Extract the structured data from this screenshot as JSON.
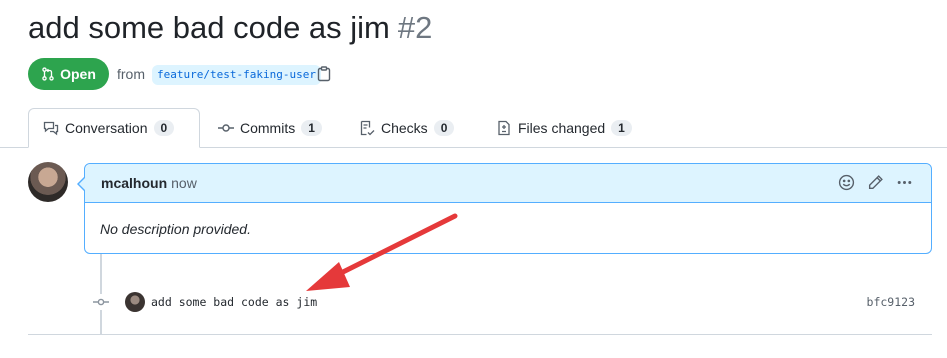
{
  "pr": {
    "title": "add some bad code as jim",
    "number": "#2",
    "state": "Open",
    "from_label": "from",
    "branch": "feature/test-faking-user"
  },
  "tabs": [
    {
      "label": "Conversation",
      "count": "0",
      "icon": "comment-discussion-icon"
    },
    {
      "label": "Commits",
      "count": "1",
      "icon": "git-commit-icon"
    },
    {
      "label": "Checks",
      "count": "0",
      "icon": "checklist-icon"
    },
    {
      "label": "Files changed",
      "count": "1",
      "icon": "file-diff-icon"
    }
  ],
  "comment": {
    "author": "mcalhoun",
    "time": "now",
    "body": "No description provided."
  },
  "commit": {
    "message": "add some bad code as jim",
    "sha": "bfc9123"
  },
  "colors": {
    "open_green": "#2da44e",
    "accent_blue": "#0969da",
    "annotation_red": "#e5393a"
  }
}
